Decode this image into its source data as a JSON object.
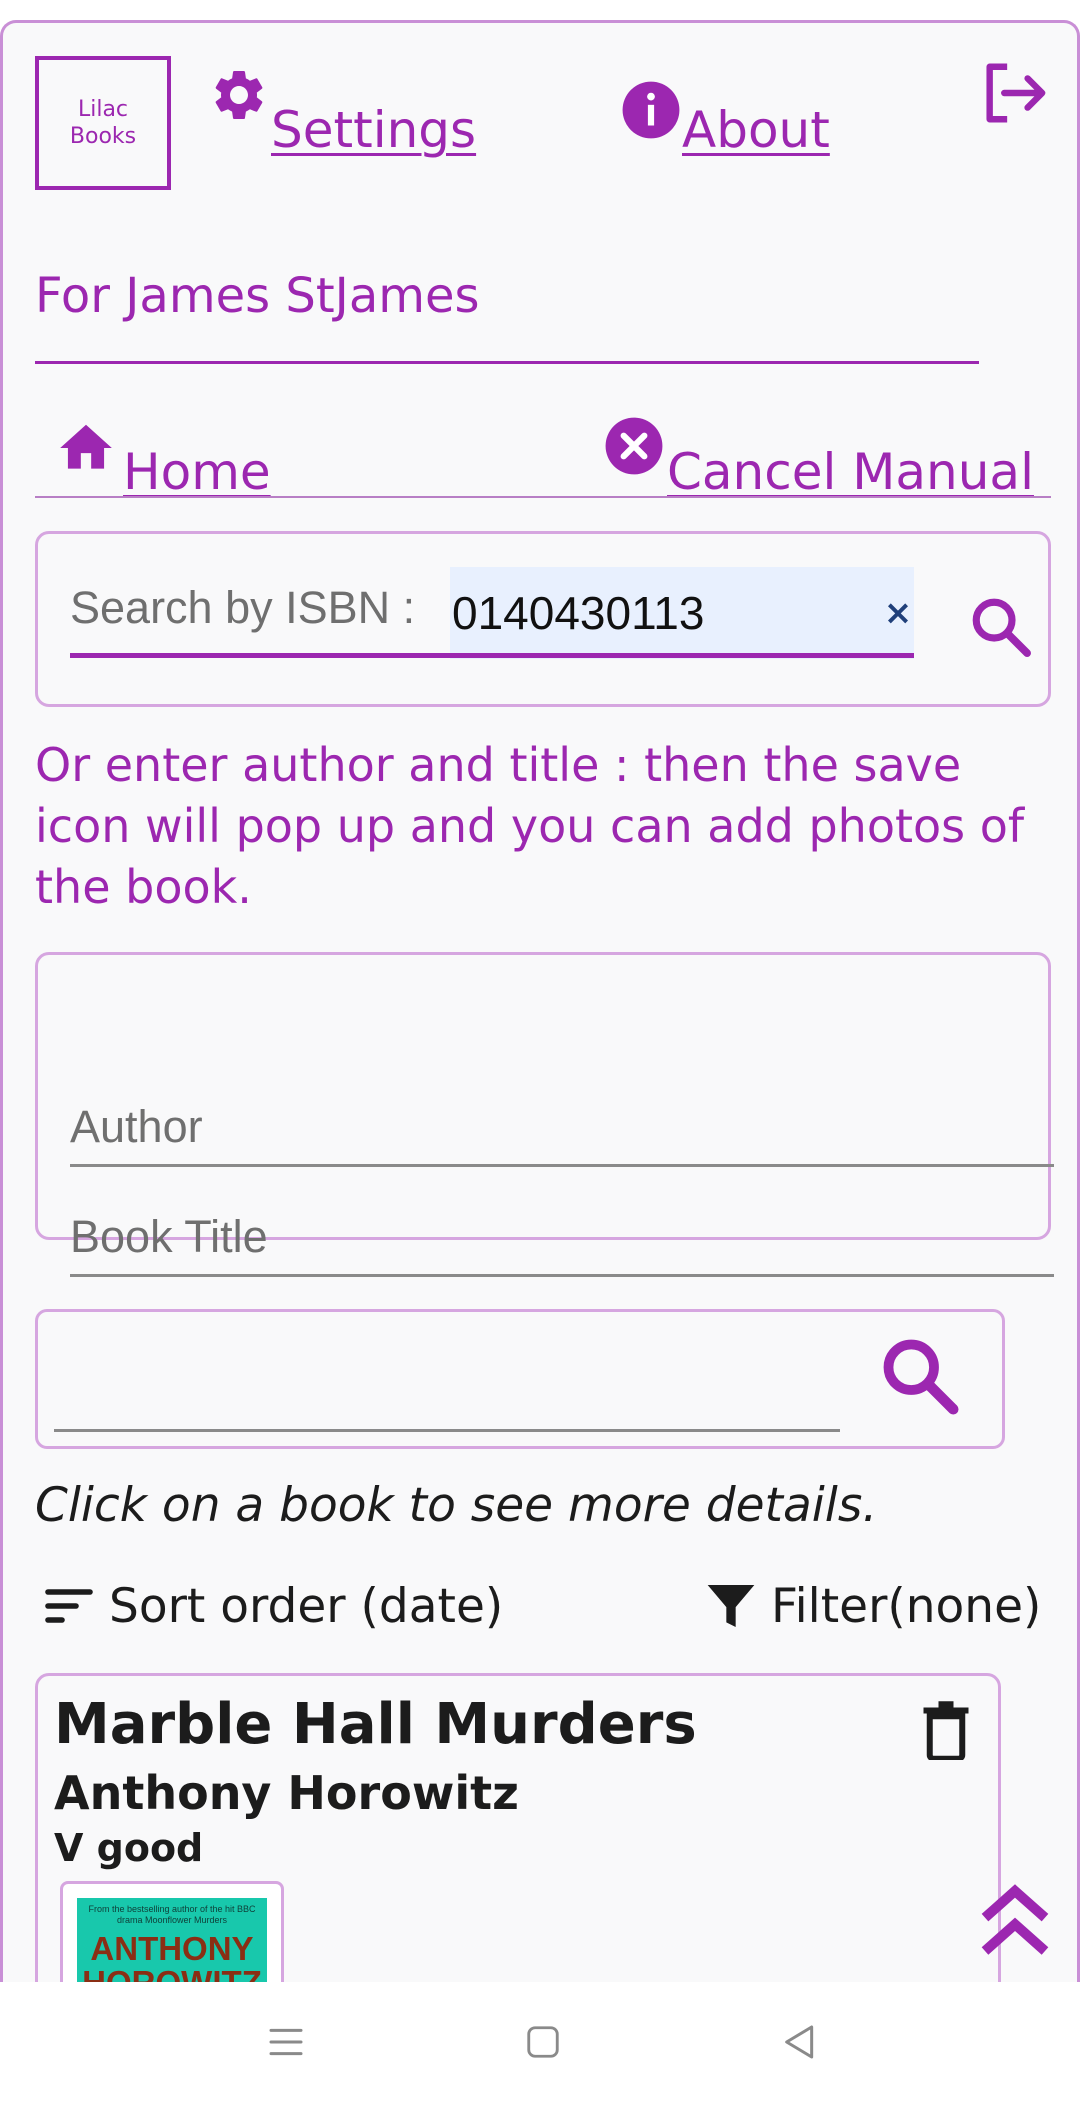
{
  "header": {
    "logo_line1": "Lilac",
    "logo_line2": "Books",
    "settings_label": " Settings",
    "about_label": " About"
  },
  "user": {
    "for_label": "For James StJames"
  },
  "nav": {
    "home_label": "Home",
    "cancel_label": " Cancel Manual"
  },
  "isbn": {
    "label": "Search by ISBN :",
    "value": "0140430113",
    "clear_glyph": "×"
  },
  "instructions": "Or enter author and title : then the save icon will pop up and you can add photos of the book.",
  "manual": {
    "author_placeholder": "Author",
    "title_placeholder": "Book Title"
  },
  "library_search": {
    "value": ""
  },
  "click_hint": "Click on a book to see more details.",
  "controls": {
    "sort_label": "Sort order (date)",
    "filter_label": "Filter(none)"
  },
  "books": [
    {
      "title": "Marble Hall Murders",
      "author": "Anthony Horowitz",
      "condition": "V good",
      "cover_tagline": "From the bestselling author of the hit BBC drama Moonflower Murders",
      "cover_line1": "ANTHONY",
      "cover_line2": "HOROWITZ"
    }
  ],
  "colors": {
    "accent": "#9c27b0",
    "border": "#d6a6e0",
    "background": "#f9f9fa",
    "autofill": "#e8f0fe"
  },
  "icons": [
    "settings-gear-icon",
    "info-icon",
    "logout-icon",
    "home-icon",
    "cancel-circle-icon",
    "search-icon",
    "sort-icon",
    "filter-icon",
    "delete-icon",
    "scroll-top-icon"
  ]
}
